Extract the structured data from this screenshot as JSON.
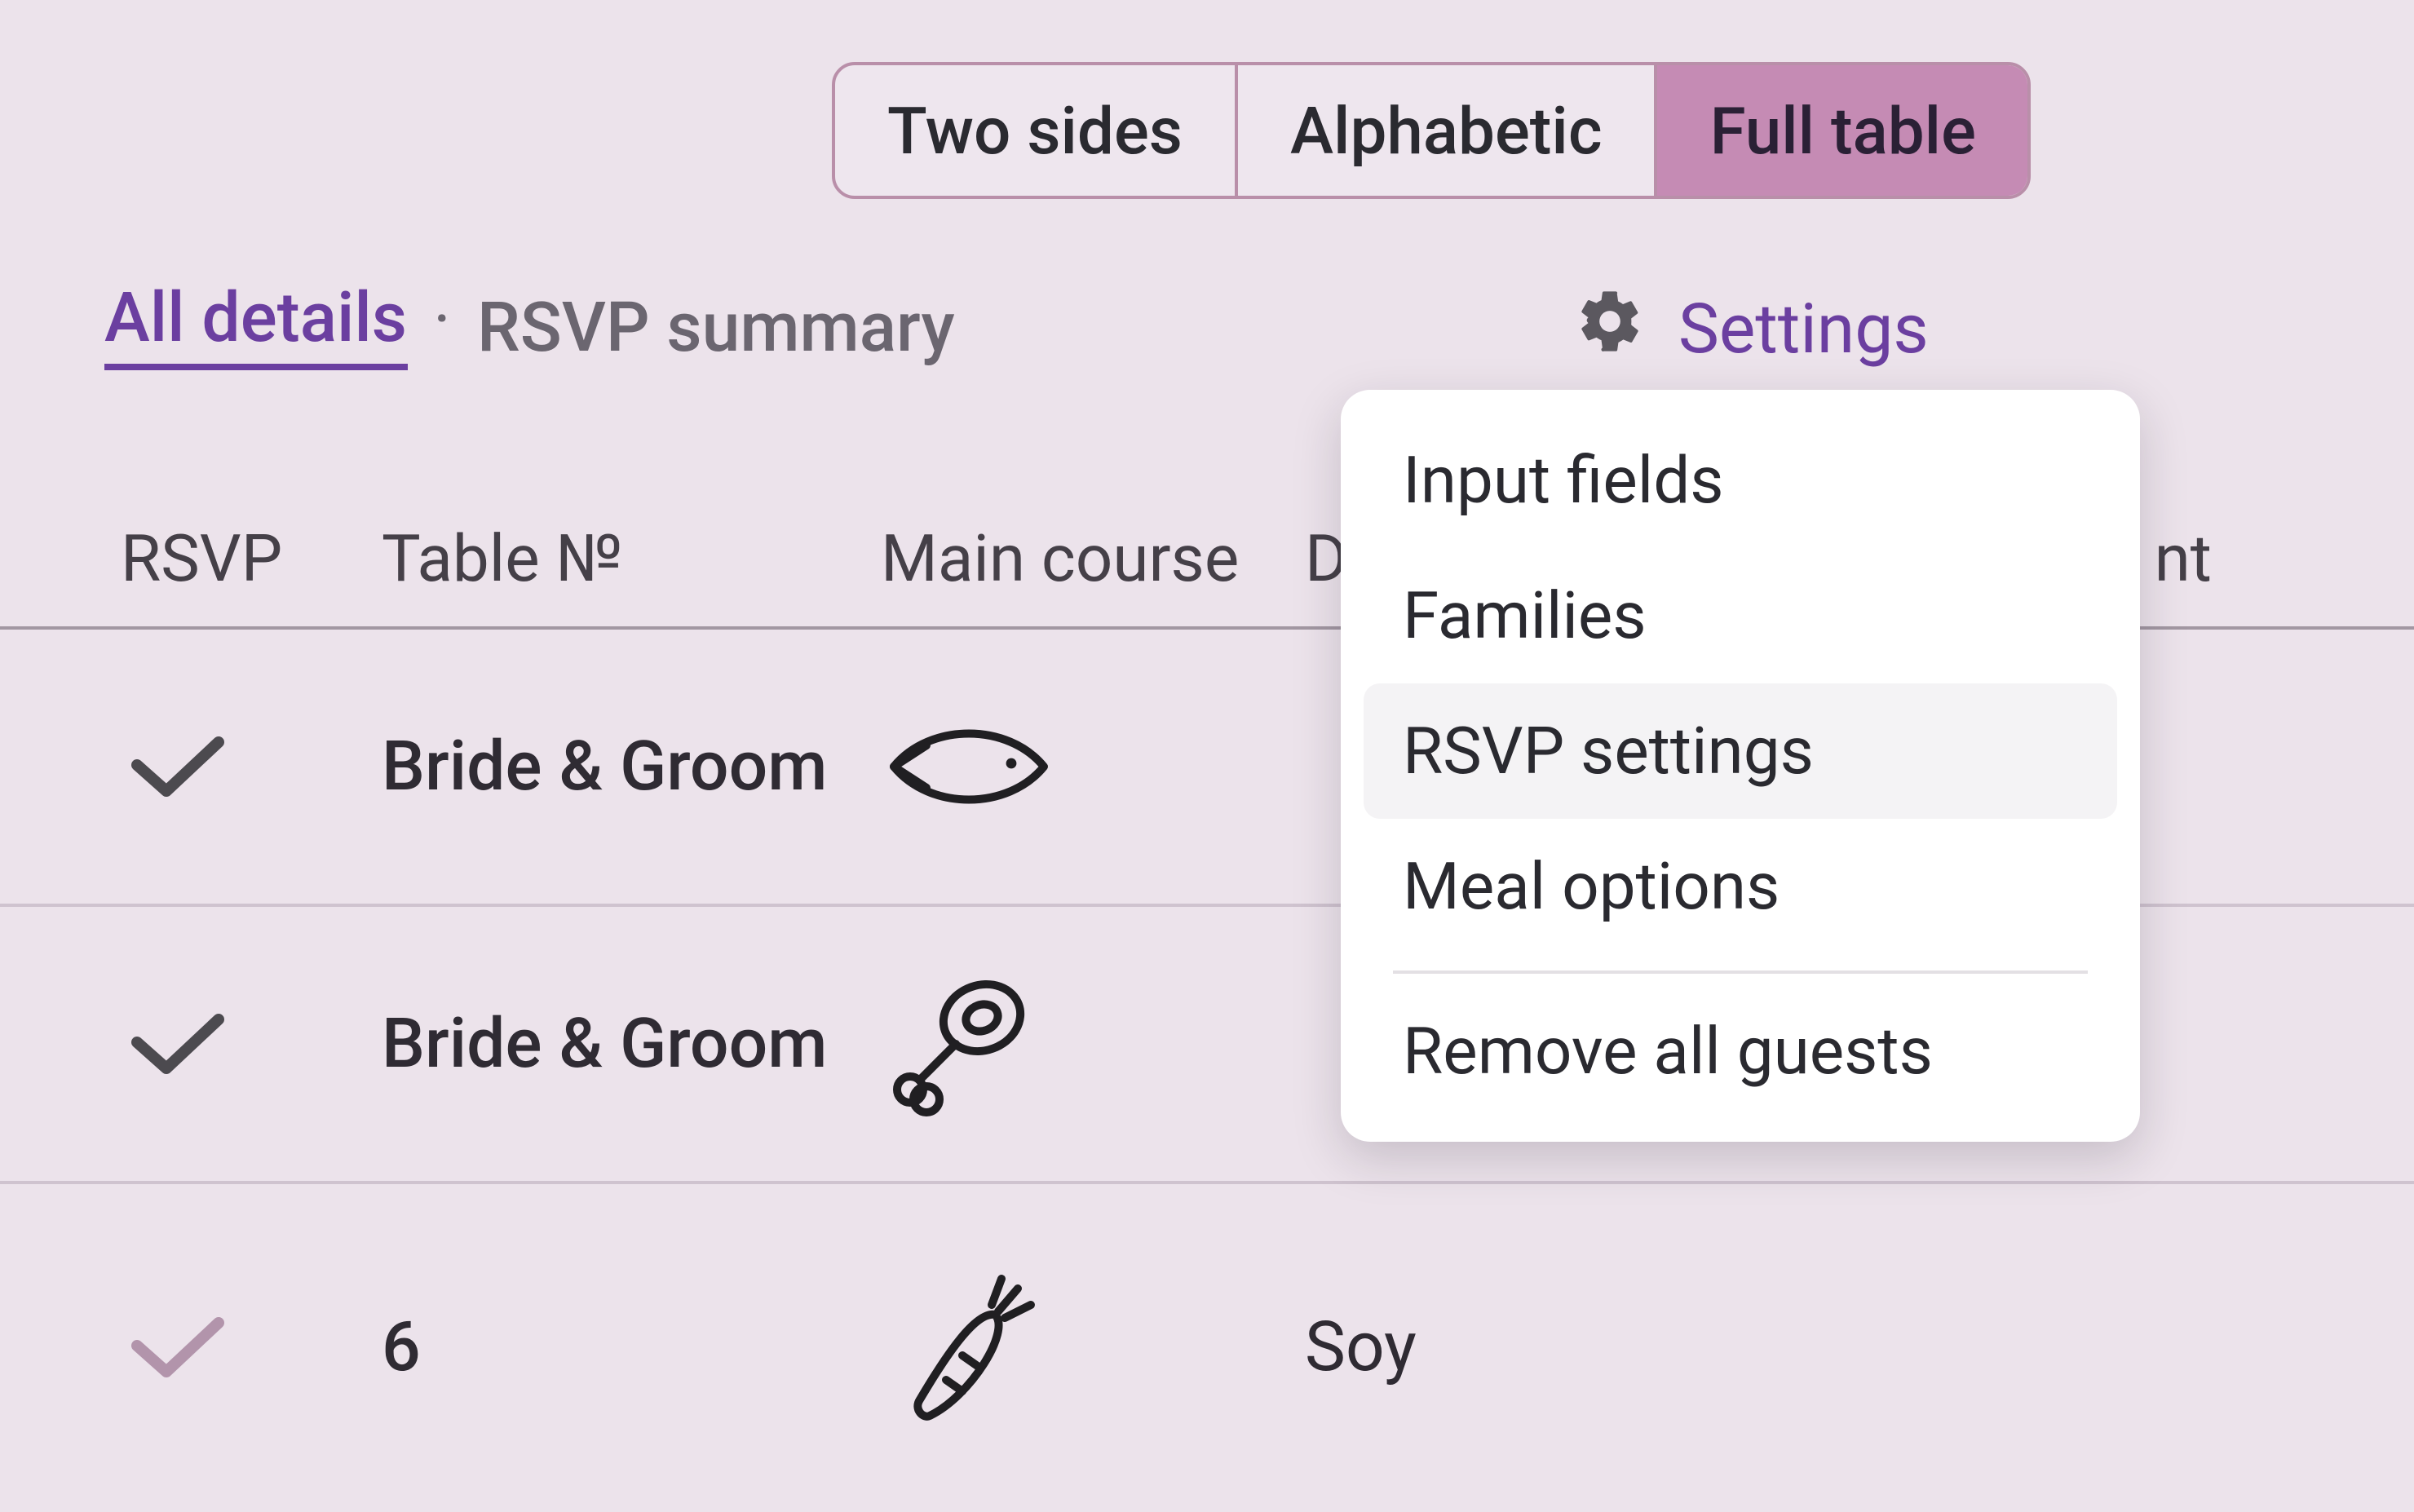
{
  "segmented": {
    "items": [
      {
        "label": "Two sides",
        "selected": false
      },
      {
        "label": "Alphabetic",
        "selected": false
      },
      {
        "label": "Full table",
        "selected": true
      }
    ]
  },
  "subnav": {
    "all_details": "All details",
    "separator": "·",
    "rsvp_summary": "RSVP summary"
  },
  "settings": {
    "label": "Settings",
    "menu": [
      {
        "label": "Input fields",
        "hover": false,
        "sep_after": false
      },
      {
        "label": "Families",
        "hover": false,
        "sep_after": false
      },
      {
        "label": "RSVP settings",
        "hover": true,
        "sep_after": false
      },
      {
        "label": "Meal options",
        "hover": false,
        "sep_after": true
      },
      {
        "label": "Remove all guests",
        "hover": false,
        "sep_after": false
      }
    ]
  },
  "table": {
    "headers": {
      "rsvp": "RSVP",
      "table_no": "Table №",
      "main_course": "Main course",
      "d_col": "D",
      "nt_col": "nt"
    },
    "rows": [
      {
        "rsvp": "confirmed",
        "table": "Bride & Groom",
        "main_course_icon": "fish",
        "d_col": ""
      },
      {
        "rsvp": "confirmed",
        "table": "Bride & Groom",
        "main_course_icon": "meat",
        "d_col": ""
      },
      {
        "rsvp": "tentative",
        "table": "6",
        "main_course_icon": "carrot",
        "d_col": "Soy"
      }
    ]
  }
}
